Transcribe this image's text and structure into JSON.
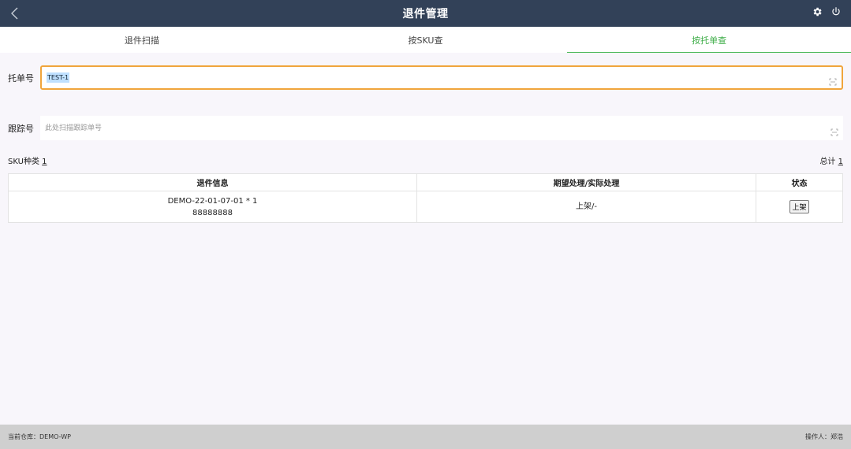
{
  "header": {
    "title": "退件管理"
  },
  "tabs": [
    {
      "label": "退件扫描"
    },
    {
      "label": "按SKU查"
    },
    {
      "label": "按托单查"
    }
  ],
  "pallet": {
    "label": "托单号",
    "value": "TEST-1",
    "placeholder": ""
  },
  "tracking": {
    "label": "跟踪号",
    "value": "",
    "placeholder": "此处扫描跟踪单号"
  },
  "summary": {
    "sku_label": "SKU种类",
    "sku_count": "1",
    "total_label": "总计",
    "total_count": "1"
  },
  "table": {
    "headers": [
      "退件信息",
      "期望处理/实际处理",
      "状态"
    ],
    "rows": [
      {
        "info_line1": "DEMO-22-01-07-01 * 1",
        "info_line2": "88888888",
        "handling": "上架/-",
        "status_button": "上架"
      }
    ]
  },
  "footer": {
    "warehouse": "当前仓库：DEMO-WP",
    "operator": "操作人：郑浩"
  },
  "colors": {
    "header_bg": "#324158",
    "active_tab": "#3fae49",
    "focus_border": "#f0a53c",
    "footer_bg": "#cfcfcf"
  },
  "icons": {
    "back": "chevron-left-icon",
    "settings": "gear-icon",
    "power": "power-icon",
    "scan": "scan-icon"
  }
}
